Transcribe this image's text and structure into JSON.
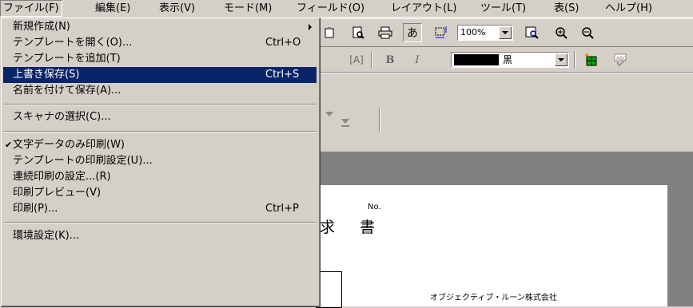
{
  "menubar": {
    "items": [
      "ファイル(F)",
      "編集(E)",
      "表示(V)",
      "モード(M)",
      "フィールド(O)",
      "レイアウト(L)",
      "ツール(T)",
      "表(S)",
      "ヘルプ(H)"
    ]
  },
  "file_menu": {
    "items": [
      {
        "label": "新規作成(N)",
        "shortcut": "",
        "submenu": true
      },
      {
        "label": "テンプレートを開く(O)...",
        "shortcut": "Ctrl+O"
      },
      {
        "label": "テンプレートを追加(T)",
        "shortcut": ""
      },
      {
        "label": "上書き保存(S)",
        "shortcut": "Ctrl+S",
        "selected": true
      },
      {
        "label": "名前を付けて保存(A)...",
        "shortcut": ""
      },
      {
        "label": "スキャナの選択(C)...",
        "shortcut": ""
      },
      {
        "label": "文字データのみ印刷(W)",
        "shortcut": "",
        "checked": true
      },
      {
        "label": "テンプレートの印刷設定(U)...",
        "shortcut": ""
      },
      {
        "label": "連続印刷の設定...(R)",
        "shortcut": ""
      },
      {
        "label": "印刷プレビュー(V)",
        "shortcut": ""
      },
      {
        "label": "印刷(P)...",
        "shortcut": "Ctrl+P"
      },
      {
        "label": "環境設定(K)...",
        "shortcut": ""
      }
    ]
  },
  "toolbar": {
    "zoom_value": "100%",
    "color_name": "黒",
    "colors": {
      "highlight": "#0a246a",
      "menu_bg": "#d4d0c8"
    }
  },
  "document": {
    "title_fragment": "求　書",
    "no_label": "No.",
    "company": "オブジェクティブ・ルーン株式会社"
  }
}
